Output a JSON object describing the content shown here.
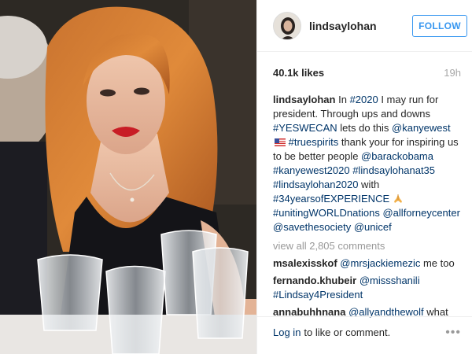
{
  "post": {
    "username": "lindsaylohan",
    "follow_label": "FOLLOW",
    "likes": "40.1k likes",
    "time": "19h",
    "caption": {
      "username": "lindsaylohan",
      "t1": "In ",
      "h1": "#2020",
      "t2": " I may run for president. Through ups and downs ",
      "h2": "#YESWECAN",
      "t3": " lets do this ",
      "h3": "@kanyewest",
      "h4": "#truespirits",
      "t4": " thank your for inspiring us to be better people ",
      "h5": "@barackobama",
      "h6": "#kanyewest2020",
      "h7": "#lindsaylohanat35",
      "h8": "#lindsaylohan2020",
      "t5": " with ",
      "h9": "#34yearsofEXPERIENCE",
      "h10": "#unitingWORLDnations",
      "h11": "@allforneycenter",
      "h12": "@savethesociety",
      "h13": "@unicef"
    },
    "view_all": "view all 2,805 comments",
    "comments": [
      {
        "username": "msalexisskof",
        "mention": "@mrsjackiemezic",
        "text": " me too"
      },
      {
        "username": "fernando.khubeir",
        "mention": "@missshanili",
        "tag": "#Lindsay4President"
      },
      {
        "username": "annabuhhnana",
        "mention": "@allyandthewolf",
        "text": " what"
      }
    ],
    "footer": {
      "login": "Log in",
      "rest": "to like or comment."
    }
  },
  "icons": {
    "flag": "us-flag-icon",
    "pray": "praying-hands-icon",
    "more": "more-options-icon"
  },
  "colors": {
    "follow_blue": "#3897f0",
    "link_blue": "#003569",
    "muted": "#999999"
  }
}
